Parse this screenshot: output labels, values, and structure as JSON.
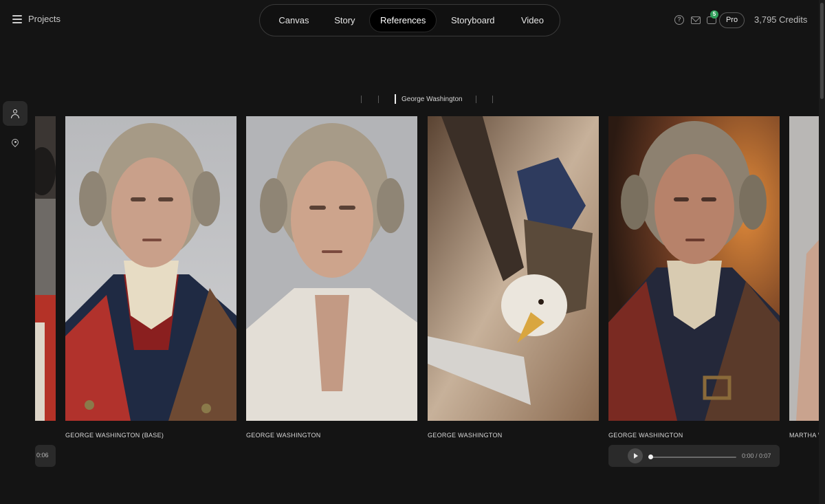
{
  "topbar": {
    "projects_label": "Projects",
    "tabs": [
      {
        "label": "Canvas"
      },
      {
        "label": "Story"
      },
      {
        "label": "References",
        "active": true
      },
      {
        "label": "Storyboard"
      },
      {
        "label": "Video"
      }
    ],
    "notification_count": "5",
    "plan_label": "Pro",
    "credits": "3,795 Credits"
  },
  "left_rail": {
    "items": [
      {
        "icon": "person-icon",
        "active": true
      },
      {
        "icon": "location-pin-icon",
        "active": false
      }
    ]
  },
  "scrubber": {
    "active_label": "George Washington"
  },
  "cards": [
    {
      "caption": "",
      "description": "partial portrait, red uniform"
    },
    {
      "caption": "GEORGE WASHINGTON (BASE)"
    },
    {
      "caption": "GEORGE WASHINGTON"
    },
    {
      "caption": "GEORGE WASHINGTON"
    },
    {
      "caption": "GEORGE WASHINGTON"
    },
    {
      "caption": "MARTHA W"
    }
  ],
  "audio": {
    "left_time": "0:06",
    "main_time": "0:00 / 0:07",
    "progress": 0.0
  },
  "colors": {
    "background": "#141414",
    "nav_active": "#000000",
    "badge": "#2f9e5a",
    "player": "#2a2a2a"
  }
}
